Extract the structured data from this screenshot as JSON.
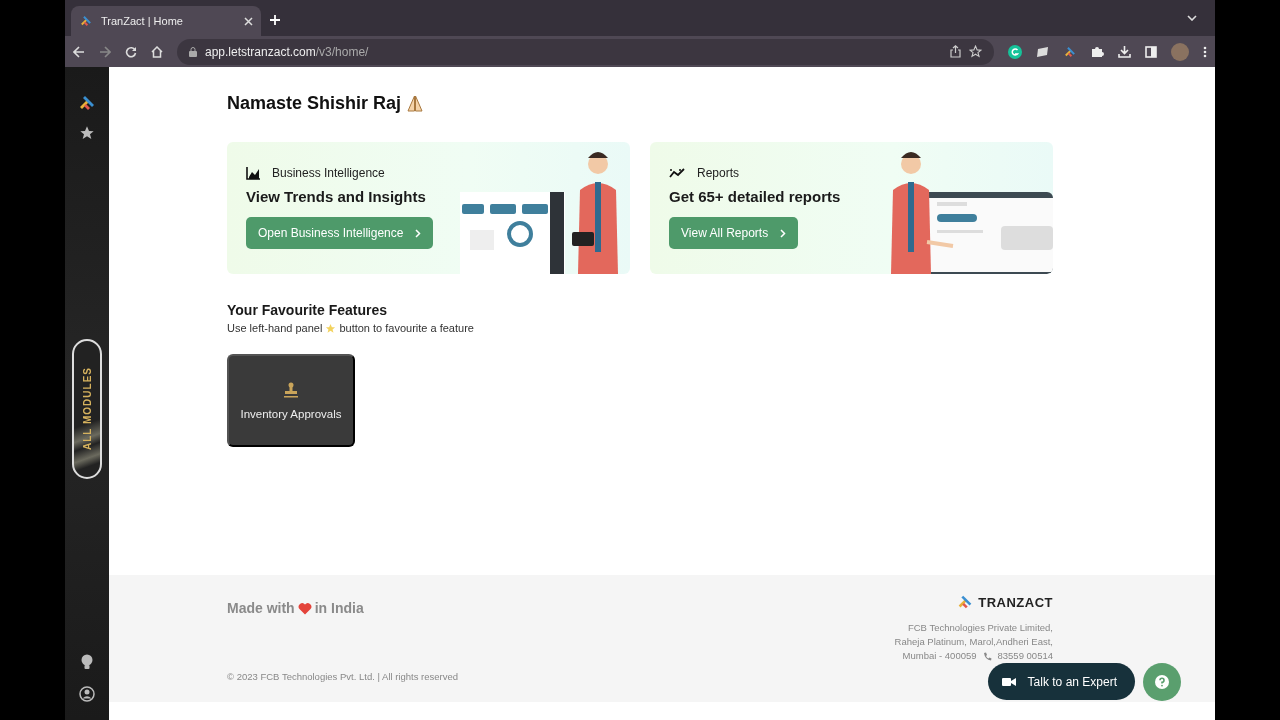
{
  "browser": {
    "tab": {
      "title": "TranZact | Home",
      "selected": true
    },
    "url": {
      "host": "app.letstranzact.com",
      "path": "/v3/home/"
    }
  },
  "sidebar": {
    "modules_label": "ALL MODULES"
  },
  "greeting": "Namaste Shishir Raj",
  "cards": [
    {
      "kind": "bi",
      "label": "Business Intelligence",
      "title": "View Trends and Insights",
      "button": "Open Business Intelligence"
    },
    {
      "kind": "reports",
      "label": "Reports",
      "title": "Get 65+ detailed reports",
      "button": "View All Reports"
    }
  ],
  "favourites": {
    "title": "Your Favourite Features",
    "hint_before": "Use left-hand panel",
    "hint_after": "button to favourite a feature",
    "items": [
      {
        "label": "Inventory Approvals"
      }
    ]
  },
  "footer": {
    "made_before": "Made with",
    "made_after": "in India",
    "copyright": "© 2023 FCB Technologies Pvt. Ltd. | All rights reserved",
    "brand": "TRANZACT",
    "address": [
      "FCB Technologies Private Limited,",
      "Raheja Platinum, Marol,Andheri East,"
    ],
    "city": "Mumbai - 400059",
    "phone": "83559 00514"
  },
  "floating": {
    "expert": "Talk to an Expert"
  }
}
